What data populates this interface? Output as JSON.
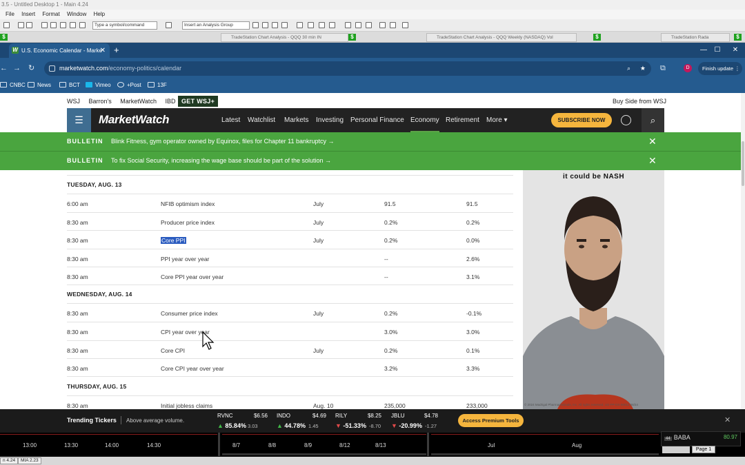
{
  "host_app": {
    "title": "3.5 - Untitled Desktop 1 - Main 4.24",
    "menu": [
      "File",
      "Insert",
      "Format",
      "Window",
      "Help"
    ],
    "symbol_placeholder": "Type a symbol/command",
    "analysis_group_placeholder": "Insert an Analysis Group",
    "sub_tabs": [
      "TradeStation Chart Analysis - QQQ 30 min IN",
      "TradeStation Chart Analysis - QQQ Weekly (NASDAQ) Vol",
      "TradeStation Rada"
    ]
  },
  "browser": {
    "tab_title": "U.S. Economic Calendar - Marke",
    "url_domain": "marketwatch.com",
    "url_path": "/economy-politics/calendar",
    "finish_update": "Finish update",
    "profile_initial": "D",
    "bookmarks": [
      "CNBC",
      "News",
      "BCT",
      "Vimeo",
      "+Post",
      "13F"
    ]
  },
  "site": {
    "dj_links": [
      "WSJ",
      "Barron's",
      "MarketWatch",
      "IBD"
    ],
    "get_wsj": "GET WSJ+",
    "buy_side": "Buy Side from WSJ",
    "logo": "MarketWatch",
    "nav": [
      "Latest",
      "Watchlist",
      "Markets",
      "Investing",
      "Personal Finance",
      "Economy",
      "Retirement",
      "More ▾"
    ],
    "active_nav": "Economy",
    "subscribe": "SUBSCRIBE NOW",
    "bulletins": [
      {
        "tag": "BULLETIN",
        "text": "Blink Fitness, gym operator owned by Equinox, files for Chapter 11 bankruptcy →"
      },
      {
        "tag": "BULLETIN",
        "text": "To fix Social Security, increasing the wage base should be part of the solution →"
      }
    ]
  },
  "calendar": {
    "days": [
      {
        "label": "TUESDAY, AUG. 13",
        "rows": [
          {
            "time": "6:00 am",
            "report": "NFIB optimism index",
            "period": "July",
            "forecast": "91.5",
            "previous": "91.5"
          },
          {
            "time": "8:30 am",
            "report": "Producer price index",
            "period": "July",
            "forecast": "0.2%",
            "previous": "0.2%"
          },
          {
            "time": "8:30 am",
            "report": "Core PPI",
            "period": "July",
            "forecast": "0.2%",
            "previous": "0.0%",
            "highlighted": true
          },
          {
            "time": "8:30 am",
            "report": "PPI year over year",
            "period": "",
            "forecast": "--",
            "previous": "2.6%"
          },
          {
            "time": "8:30 am",
            "report": "Core PPI year over year",
            "period": "",
            "forecast": "--",
            "previous": "3.1%"
          }
        ]
      },
      {
        "label": "WEDNESDAY, AUG. 14",
        "rows": [
          {
            "time": "8:30 am",
            "report": "Consumer price index",
            "period": "July",
            "forecast": "0.2%",
            "previous": "-0.1%"
          },
          {
            "time": "8:30 am",
            "report": "CPI year over year",
            "period": "",
            "forecast": "3.0%",
            "previous": "3.0%"
          },
          {
            "time": "8:30 am",
            "report": "Core CPI",
            "period": "July",
            "forecast": "0.2%",
            "previous": "0.1%"
          },
          {
            "time": "8:30 am",
            "report": "Core CPI year over year",
            "period": "",
            "forecast": "3.2%",
            "previous": "3.3%"
          }
        ]
      },
      {
        "label": "THURSDAY, AUG. 15",
        "rows": [
          {
            "time": "8:30 am",
            "report": "Initial jobless claims",
            "period": "Aug. 10",
            "forecast": "235,000",
            "previous": "233,000"
          }
        ]
      }
    ]
  },
  "ad": {
    "tagline": "it could be NASH",
    "fine_print": "© 2024 Madrigal Pharmaceuticals, Inc. All rights reserved. US-PP-DS-00012   08/24"
  },
  "trending": {
    "title": "Trending Tickers",
    "subtitle": "Above average volume.",
    "tickers": [
      {
        "symbol": "RVNC",
        "price": "$6.56",
        "pct": "85.84%",
        "change": "3.03",
        "direction": "up"
      },
      {
        "symbol": "INDO",
        "price": "$4.69",
        "pct": "44.78%",
        "change": "1.45",
        "direction": "up"
      },
      {
        "symbol": "RILY",
        "price": "$8.25",
        "pct": "-51.33%",
        "change": "-8.70",
        "direction": "down"
      },
      {
        "symbol": "JBLU",
        "price": "$4.78",
        "pct": "-20.99%",
        "change": "-1.27",
        "direction": "down"
      }
    ],
    "premium": "Access Premium Tools"
  },
  "charts": {
    "axis1": [
      "13:00",
      "13:30",
      "14:00",
      "14:30"
    ],
    "axis2": [
      "8/7",
      "8/8",
      "8/9",
      "8/12",
      "8/13"
    ],
    "axis3": [
      "Jul",
      "Aug"
    ],
    "quote": {
      "symbol": "BABA",
      "value": "80.97",
      "row": "44"
    },
    "page_label": "Page 1"
  },
  "status": {
    "tabs": [
      "n 4.24",
      "MIA 2.23"
    ]
  }
}
